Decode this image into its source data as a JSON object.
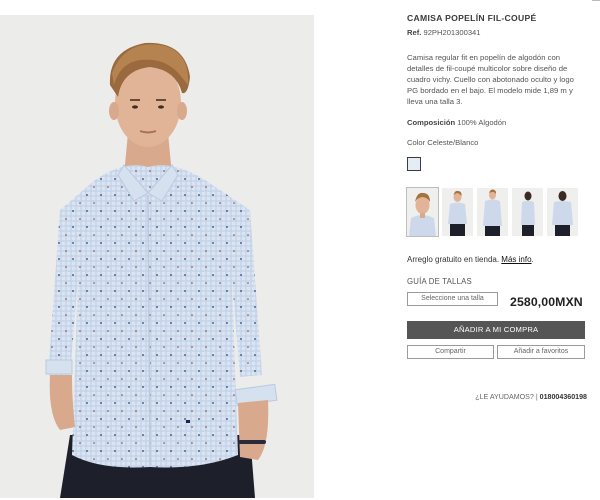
{
  "product": {
    "title": "CAMISA POPELÍN FIL-COUPÉ",
    "ref_label": "Ref.",
    "ref_value": "92PH201300341",
    "description": "Camisa regular fit en popelín de algodón con detalles de fil-coupé multicolor sobre diseño de cuadro vichy. Cuello con abotonado oculto y logo PG bordado en el bajo. El modelo mide 1,89 m y lleva una talla 3.",
    "composition_label": "Composición",
    "composition_value": "100% Algodón",
    "color_label": "Color",
    "color_value": "Celeste/Blanco",
    "swatch_color": "#e4ecf6"
  },
  "thumbnails": [
    {
      "name": "thumb-closeup"
    },
    {
      "name": "thumb-front"
    },
    {
      "name": "thumb-front-full"
    },
    {
      "name": "thumb-side"
    },
    {
      "name": "thumb-back"
    }
  ],
  "store": {
    "arreglo_text": "Arreglo gratuito en tienda.",
    "mas_info_link": "Más info",
    "period": ".",
    "size_guide": "GUÍA DE TALLAS"
  },
  "purchase": {
    "size_placeholder": "Seleccione una talla",
    "price": "2580,00MXN",
    "add_button": "AÑADIR A MI COMPRA",
    "share_button": "Compartir",
    "fav_button": "Añadir a favoritos"
  },
  "help": {
    "question": "¿LE AYUDAMOS?",
    "separator": "|",
    "phone": "018004360198"
  },
  "colors": {
    "button_bg": "#555555",
    "shirt_blue": "#c9d7ea",
    "background": "#ececeb"
  }
}
